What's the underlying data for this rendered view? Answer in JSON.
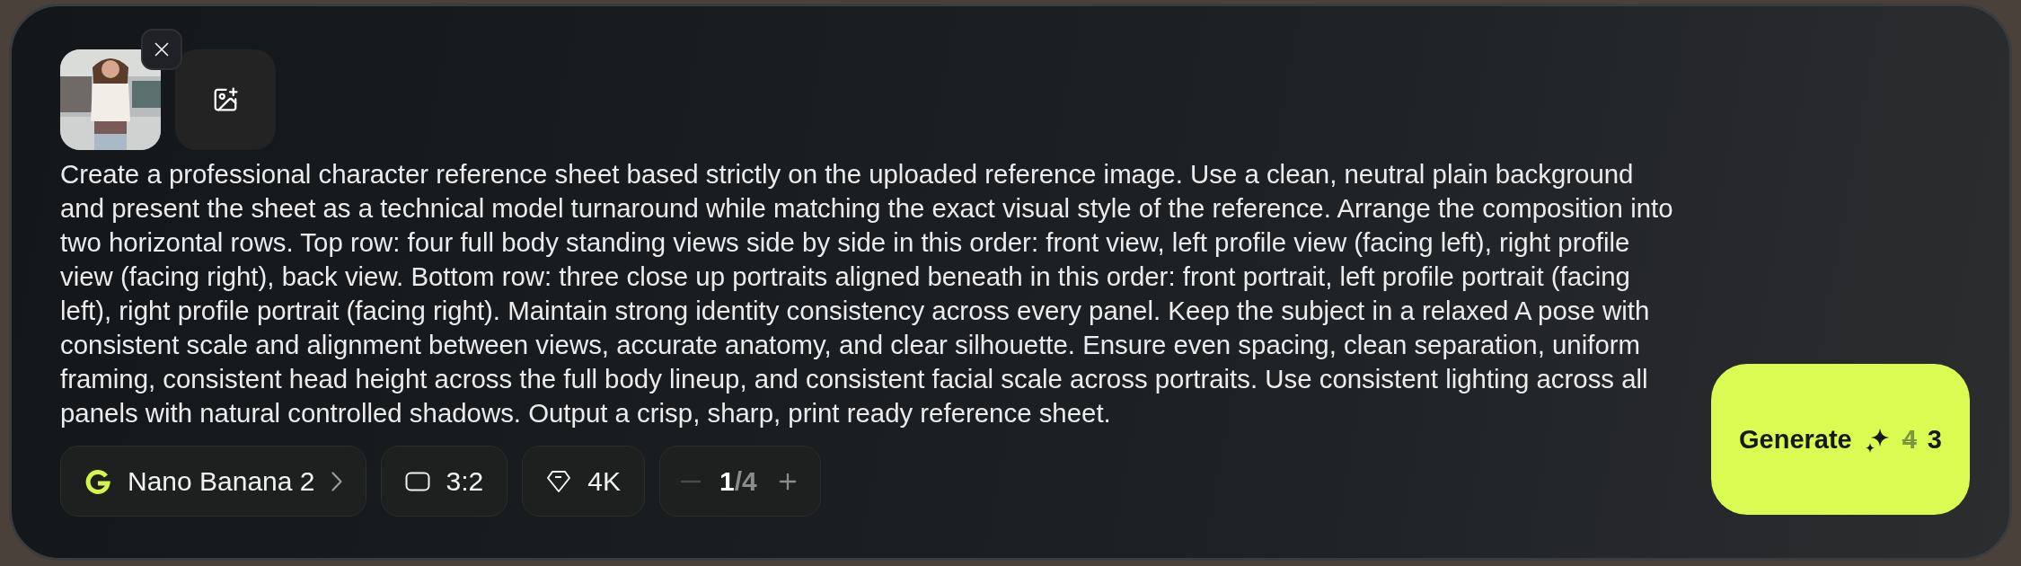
{
  "prompt": {
    "value": "Create a professional character reference sheet based strictly on the uploaded reference image. Use a clean, neutral plain background and present the sheet as a technical model turnaround while matching the exact visual style of the reference. Arrange the composition into two horizontal rows. Top row: four full body standing views side by side in this order: front view, left profile view (facing left), right profile view (facing right), back view. Bottom row: three close up portraits aligned beneath in this order: front portrait, left profile portrait (facing left), right profile portrait (facing right). Maintain strong identity consistency across every panel. Keep the subject in a relaxed A pose with consistent scale and alignment between views, accurate anatomy, and clear silhouette. Ensure even spacing, clean separation, uniform framing, consistent head height across the full body lineup, and consistent facial scale across portraits. Use consistent lighting across all panels with natural controlled shadows. Output a crisp, sharp, print ready reference sheet."
  },
  "model": {
    "name": "Nano Banana 2"
  },
  "aspect_ratio": "3:2",
  "resolution": "4K",
  "count": {
    "value": "1",
    "total": "/4",
    "minus_disabled": true,
    "plus_disabled": false
  },
  "generate": {
    "label": "Generate",
    "old_cost": "4",
    "cost": "3"
  }
}
